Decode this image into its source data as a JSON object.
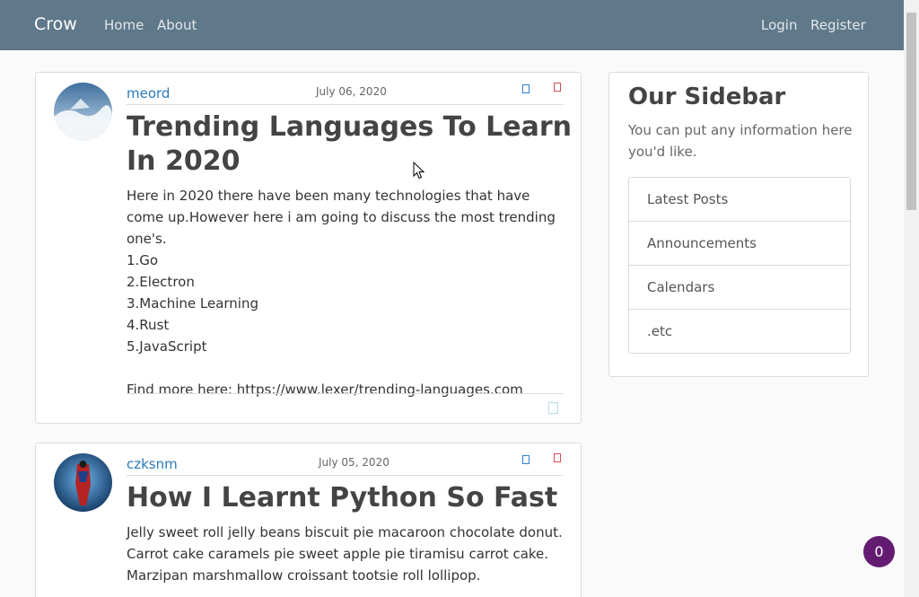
{
  "nav": {
    "brand": "Crow",
    "links": [
      "Home",
      "About"
    ],
    "right_links": [
      "Login",
      "Register"
    ]
  },
  "posts": [
    {
      "author": "meord",
      "date": "July 06, 2020",
      "title": "Trending Languages To Learn In 2020",
      "body": "Here in 2020 there have been many technologies that have come up.However here i am going to discuss the most trending one's.\n1.Go\n2.Electron\n3.Machine Learning\n4.Rust\n5.JavaScript\n\nFind more here: https://www.lexer/trending-languages.com"
    },
    {
      "author": "czksnm",
      "date": "July 05, 2020",
      "title": "How I Learnt Python So Fast",
      "body": "Jelly sweet roll jelly beans biscuit pie macaroon chocolate donut. Carrot cake caramels pie sweet apple pie tiramisu carrot cake. Marzipan marshmallow croissant tootsie roll lollipop."
    }
  ],
  "sidebar": {
    "title": "Our Sidebar",
    "text": "You can put any information here you'd like.",
    "items": [
      "Latest Posts",
      "Announcements",
      "Calendars",
      ".etc"
    ]
  },
  "badge": {
    "count": "0"
  },
  "colors": {
    "navbar": "#5f788a",
    "link": "#2a7ab9",
    "badge": "#641c72",
    "edit": "#2f7fd5",
    "delete": "#d64b54"
  },
  "icons": {
    "edit": "edit-icon",
    "delete": "delete-icon",
    "footer": "comment-icon",
    "cursor": "mouse-cursor-icon"
  }
}
